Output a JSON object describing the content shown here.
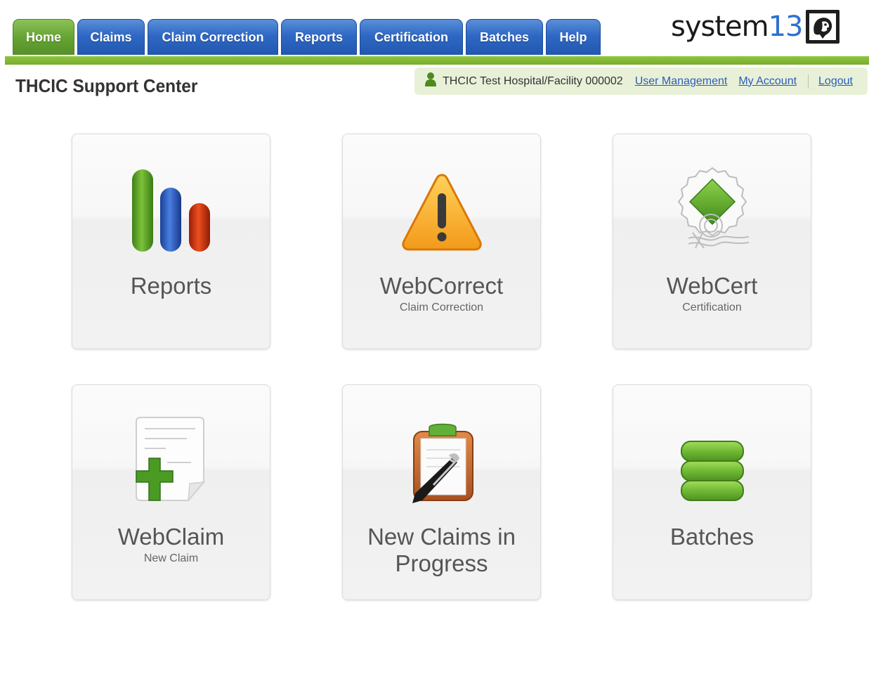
{
  "nav": {
    "tabs": [
      {
        "label": "Home"
      },
      {
        "label": "Claims"
      },
      {
        "label": "Claim Correction"
      },
      {
        "label": "Reports"
      },
      {
        "label": "Certification"
      },
      {
        "label": "Batches"
      },
      {
        "label": "Help"
      }
    ],
    "active_color": "#66a432",
    "tab_color": "#2f68c4"
  },
  "logo": {
    "text": "system",
    "number": "13"
  },
  "page_title": "THCIC Support Center",
  "user_bar": {
    "facility": "THCIC Test Hospital/Facility 000002",
    "user_management": "User Management",
    "my_account": "My Account",
    "logout": "Logout"
  },
  "tiles": [
    {
      "title": "Reports",
      "subtitle": "",
      "icon": "bar-chart-icon"
    },
    {
      "title": "WebCorrect",
      "subtitle": "Claim Correction",
      "icon": "warning-icon"
    },
    {
      "title": "WebCert",
      "subtitle": "Certification",
      "icon": "certificate-seal-icon"
    },
    {
      "title": "WebClaim",
      "subtitle": "New Claim",
      "icon": "new-document-icon"
    },
    {
      "title_line1": "New Claims in",
      "title_line2": "Progress",
      "icon": "clipboard-pen-icon"
    },
    {
      "title": "Batches",
      "subtitle": "",
      "icon": "stack-icon"
    }
  ]
}
